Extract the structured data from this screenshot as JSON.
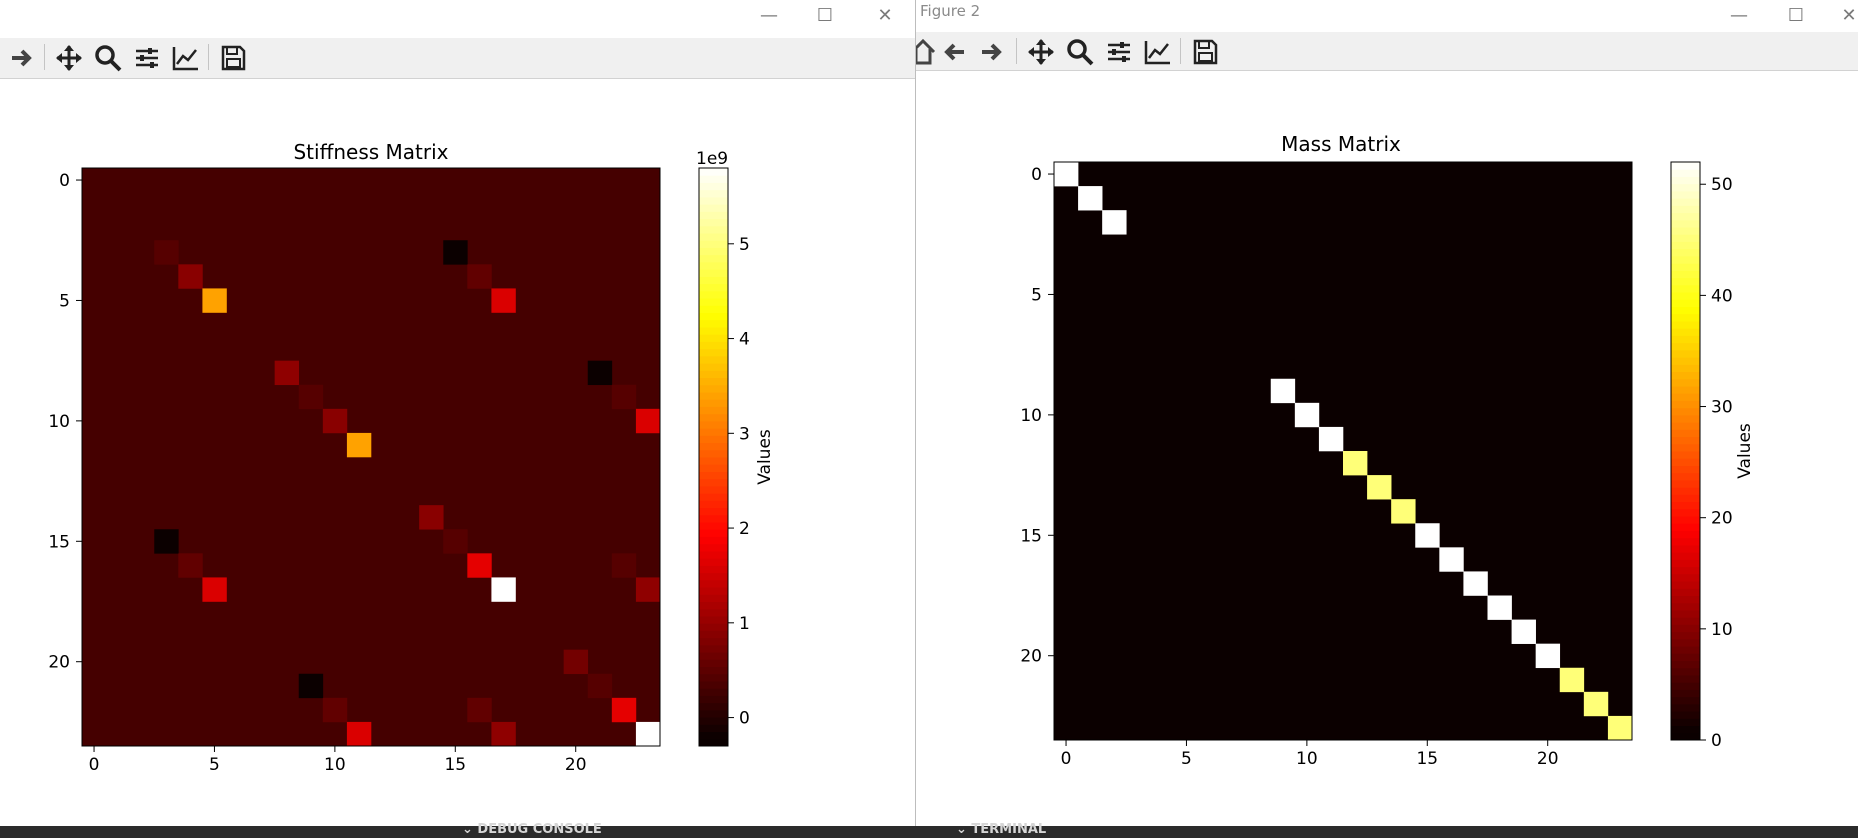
{
  "window1": {
    "controls": {
      "minimize_glyph": "—",
      "maximize_glyph": "☐",
      "close_glyph": "✕"
    },
    "toolbar": [
      "forward-icon",
      "pan-icon",
      "zoom-icon",
      "subplots-icon",
      "edit-axis-icon",
      "save-icon"
    ],
    "figure": {
      "title": "Stiffness Matrix",
      "colorbar_label": "Values",
      "colorbar_offset": "1e9"
    }
  },
  "window2": {
    "title": "Figure 2",
    "controls": {
      "minimize_glyph": "—",
      "maximize_glyph": "☐",
      "close_glyph": "✕"
    },
    "toolbar": [
      "home-icon",
      "back-icon",
      "forward-icon",
      "pan-icon",
      "zoom-icon",
      "subplots-icon",
      "edit-axis-icon",
      "save-icon"
    ],
    "figure": {
      "title": "Mass Matrix",
      "colorbar_label": "Values"
    }
  },
  "panel_tabs": {
    "debug_console": "DEBUG CONSOLE",
    "terminal": "TERMINAL"
  },
  "colors": {
    "panel_bg": "#2b2b2b",
    "toolbar_bg": "#f0f0f0",
    "colormap": "hot"
  },
  "chart_data": [
    {
      "type": "heatmap",
      "title": "Stiffness Matrix",
      "rows": 24,
      "cols": 24,
      "background": 0.3,
      "cells": [
        {
          "r": 3,
          "c": 3,
          "v": 0.45
        },
        {
          "r": 3,
          "c": 15,
          "v": -0.2
        },
        {
          "r": 4,
          "c": 4,
          "v": 0.9
        },
        {
          "r": 4,
          "c": 16,
          "v": 0.55
        },
        {
          "r": 5,
          "c": 5,
          "v": 3.4
        },
        {
          "r": 5,
          "c": 17,
          "v": 1.6
        },
        {
          "r": 8,
          "c": 8,
          "v": 0.95
        },
        {
          "r": 8,
          "c": 21,
          "v": -0.2
        },
        {
          "r": 9,
          "c": 9,
          "v": 0.45
        },
        {
          "r": 9,
          "c": 22,
          "v": 0.45
        },
        {
          "r": 10,
          "c": 10,
          "v": 0.9
        },
        {
          "r": 10,
          "c": 23,
          "v": 1.6
        },
        {
          "r": 11,
          "c": 11,
          "v": 3.4
        },
        {
          "r": 14,
          "c": 14,
          "v": 0.9
        },
        {
          "r": 15,
          "c": 3,
          "v": -0.2
        },
        {
          "r": 15,
          "c": 15,
          "v": 0.45
        },
        {
          "r": 16,
          "c": 4,
          "v": 0.55
        },
        {
          "r": 16,
          "c": 16,
          "v": 1.7
        },
        {
          "r": 16,
          "c": 22,
          "v": 0.45
        },
        {
          "r": 17,
          "c": 5,
          "v": 1.6
        },
        {
          "r": 17,
          "c": 17,
          "v": 5.8
        },
        {
          "r": 17,
          "c": 23,
          "v": 0.95
        },
        {
          "r": 20,
          "c": 20,
          "v": 0.7
        },
        {
          "r": 21,
          "c": 9,
          "v": -0.2
        },
        {
          "r": 21,
          "c": 21,
          "v": 0.45
        },
        {
          "r": 22,
          "c": 10,
          "v": 0.55
        },
        {
          "r": 22,
          "c": 16,
          "v": 0.55
        },
        {
          "r": 22,
          "c": 22,
          "v": 1.7
        },
        {
          "r": 23,
          "c": 11,
          "v": 1.6
        },
        {
          "r": 23,
          "c": 17,
          "v": 0.95
        },
        {
          "r": 23,
          "c": 23,
          "v": 5.8
        }
      ],
      "vmin": -0.3,
      "vmax": 5.8,
      "xticks": [
        0,
        5,
        10,
        15,
        20
      ],
      "yticks": [
        0,
        5,
        10,
        15,
        20
      ],
      "colorbar_ticks": [
        0,
        1,
        2,
        3,
        4,
        5
      ],
      "colorbar_label": "Values",
      "colorbar_offset": "1e9"
    },
    {
      "type": "heatmap",
      "title": "Mass Matrix",
      "rows": 24,
      "cols": 24,
      "background": 0,
      "cells": [
        {
          "r": 0,
          "c": 0,
          "v": 52
        },
        {
          "r": 1,
          "c": 1,
          "v": 52
        },
        {
          "r": 2,
          "c": 2,
          "v": 52
        },
        {
          "r": 9,
          "c": 9,
          "v": 52
        },
        {
          "r": 10,
          "c": 10,
          "v": 52
        },
        {
          "r": 11,
          "c": 11,
          "v": 52
        },
        {
          "r": 12,
          "c": 12,
          "v": 45
        },
        {
          "r": 13,
          "c": 13,
          "v": 45
        },
        {
          "r": 14,
          "c": 14,
          "v": 45
        },
        {
          "r": 15,
          "c": 15,
          "v": 52
        },
        {
          "r": 16,
          "c": 16,
          "v": 52
        },
        {
          "r": 17,
          "c": 17,
          "v": 52
        },
        {
          "r": 18,
          "c": 18,
          "v": 52
        },
        {
          "r": 19,
          "c": 19,
          "v": 52
        },
        {
          "r": 20,
          "c": 20,
          "v": 52
        },
        {
          "r": 21,
          "c": 21,
          "v": 45
        },
        {
          "r": 22,
          "c": 22,
          "v": 45
        },
        {
          "r": 23,
          "c": 23,
          "v": 45
        }
      ],
      "vmin": 0,
      "vmax": 52,
      "xticks": [
        0,
        5,
        10,
        15,
        20
      ],
      "yticks": [
        0,
        5,
        10,
        15,
        20
      ],
      "colorbar_ticks": [
        0,
        10,
        20,
        30,
        40,
        50
      ],
      "colorbar_label": "Values"
    }
  ]
}
